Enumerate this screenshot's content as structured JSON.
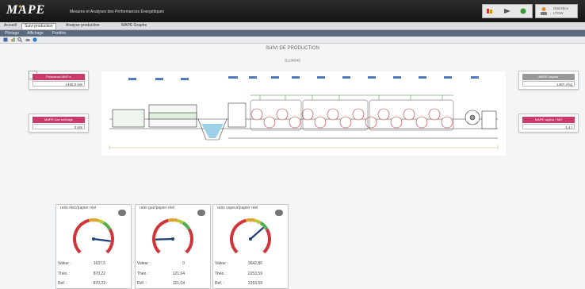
{
  "app": {
    "logo": "MAPE",
    "subtitle": "Mesures et Analyses des Performances Énergétiques"
  },
  "user": {
    "name_line1": "cbnimbco",
    "name_line2": "LTGW"
  },
  "header_icons": [
    "tools-icon",
    "download-icon",
    "status-icon"
  ],
  "tabs": [
    {
      "label": "Accueil",
      "active": false
    },
    {
      "label": "Suivi production",
      "active": true
    },
    {
      "label": "Analyse production",
      "active": false
    },
    {
      "label": "MAPE Graphe",
      "active": false
    }
  ],
  "subtabs": [
    "Pilotage",
    "Affichage",
    "Fenêtre"
  ],
  "page": {
    "title": "SUIVI DE PRODUCTION",
    "code": "SL04040"
  },
  "kpis": [
    {
      "name": "kpi-puissance",
      "label": "Puissance MAP e",
      "value": "1455,0 kW",
      "accent": "#cb3a68"
    },
    {
      "name": "kpi-gaz",
      "label": "MAPE Gaz séchage",
      "value": "0 kW",
      "accent": "#cb3a68"
    },
    {
      "name": "kpi-vapeur",
      "label": "MAPE Vapeur",
      "value": "1497,3 kg",
      "accent": "#999999"
    },
    {
      "name": "kpi-ratio-vapeur",
      "label": "MAPE vapeur / MG",
      "value": "1,4 t",
      "accent": "#cb3a68"
    }
  ],
  "gauges": [
    {
      "title": "ratio élec/papier réel",
      "needle": 0.86,
      "rows": [
        {
          "label": "Valeur :",
          "value": "1637,5"
        },
        {
          "label": "Théo. :",
          "value": "870,22"
        },
        {
          "label": "Réf. :",
          "value": "870,22"
        }
      ]
    },
    {
      "title": "ratio gaz/papier réel",
      "needle": 0.16,
      "rows": [
        {
          "label": "Valeur :",
          "value": "0"
        },
        {
          "label": "Théo. :",
          "value": "121,04"
        },
        {
          "label": "Réf. :",
          "value": "121,04"
        }
      ]
    },
    {
      "title": "ratio vapeur/papier réel",
      "needle": 0.68,
      "rows": [
        {
          "label": "Valeur :",
          "value": "3642,86"
        },
        {
          "label": "Théo. :",
          "value": "2253,59"
        },
        {
          "label": "Réf. :",
          "value": "2253,59"
        }
      ]
    }
  ]
}
